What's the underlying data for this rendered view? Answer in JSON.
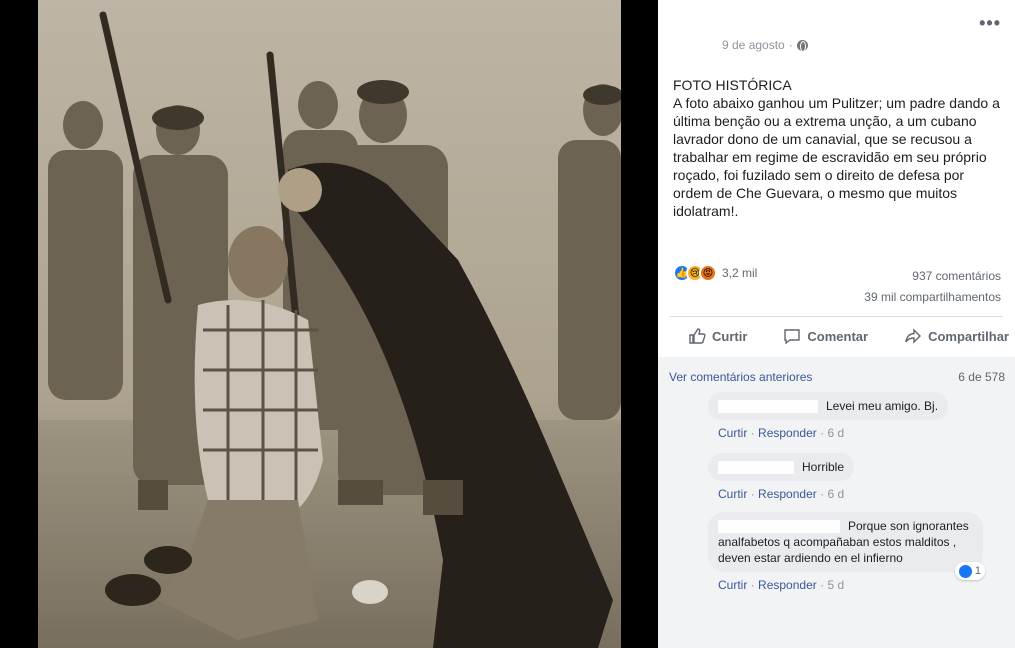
{
  "post": {
    "date": "9 de agosto",
    "more": "•••",
    "title": "FOTO HISTÓRICA",
    "body": "A foto abaixo ganhou um Pulitzer; um padre dando a última benção ou a extrema unção, a um cubano lavrador dono de um canavial, que se recusou a trabalhar em regime de escravidão em seu próprio roçado, foi fuzilado sem o direito de defesa por ordem de Che Guevara, o mesmo que muitos idolatram!."
  },
  "reactions": {
    "icons": [
      "like-icon",
      "sad-icon",
      "angry-icon"
    ],
    "count": "3,2 mil",
    "comments": "937 comentários",
    "shares": "39 mil compartilhamentos"
  },
  "actions": {
    "like": "Curtir",
    "comment": "Comentar",
    "share": "Compartilhar"
  },
  "comments_section": {
    "prev_link": "Ver comentários anteriores",
    "page": "6 de 578",
    "items": [
      {
        "text": "Levei meu amigo. Bj.",
        "like": "Curtir",
        "reply": "Responder",
        "time": "6 d"
      },
      {
        "text": "Horrible",
        "like": "Curtir",
        "reply": "Responder",
        "time": "6 d"
      },
      {
        "text": "Porque son ignorantes analfabetos q acompañaban estos malditos , deven estar ardiendo en el infierno",
        "like": "Curtir",
        "reply": "Responder",
        "time": "5 d",
        "reaction_count": "1"
      }
    ]
  },
  "colors": {
    "link": "#385898",
    "muted": "#606770",
    "bubble": "#e9ebee",
    "like_blue": "#1877f2"
  }
}
